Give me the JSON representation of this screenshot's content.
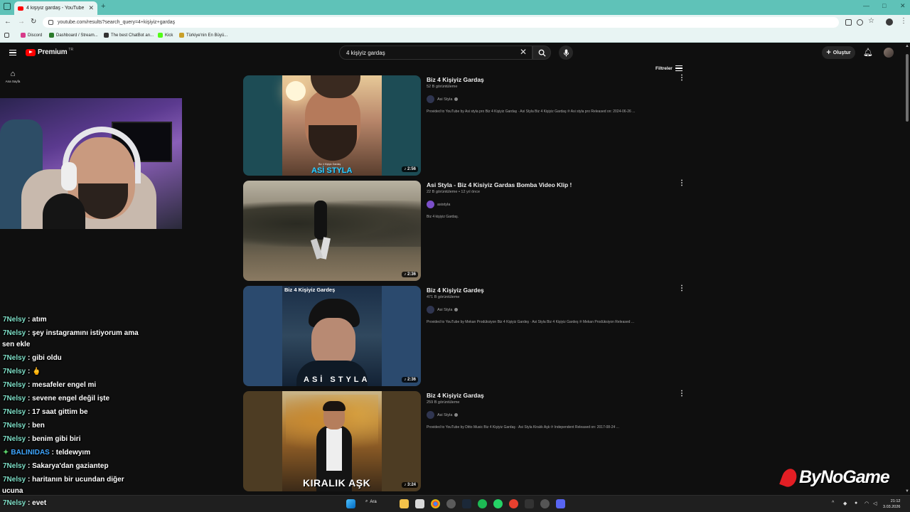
{
  "browser": {
    "tab_title": "4 kişiyiz gardaş - YouTube",
    "new_tab": "+",
    "url": "youtube.com/results?search_query=4+kişiyiz+gardaş",
    "bookmarks": [
      "Discord",
      "Dashboard / Stream...",
      "The best ChatBot an...",
      "Kick",
      "Türkiye'nin En Büyü..."
    ]
  },
  "youtube": {
    "logo_text": "Premium",
    "region": "TR",
    "search_value": "4 kişiyiz gardaş",
    "create_label": "Oluştur",
    "sidebar_home": "Ana Sayfa",
    "filters_label": "Filtreler"
  },
  "results": [
    {
      "title": "Biz 4 Kişiyiz Gardaş",
      "meta": "52 B görüntüleme",
      "channel": "Asi Styla",
      "verified": true,
      "description": "Provided to YouTube by Asi styla pro Biz 4 Kişiyiz Gardaş · Asi Styla Biz 4 Kişiyiz Gardaş ℗ Asi styla pro Released on: 2024-06-26 ...",
      "duration": "2:56",
      "thumb_text": "ASİ STYLA",
      "thumb_small": "Biz 4 Kişiyiz Gardaş"
    },
    {
      "title": "Asi Styla - Biz 4 Kisiyiz Gardas Bomba Video Klip !",
      "meta": "22 B görüntüleme • 12 yıl önce",
      "channel": "asistyla",
      "verified": false,
      "description": "Biz 4 kişiyiz Gardaş.",
      "duration": "2:36",
      "channel_avatar_color": "#7b4fc9"
    },
    {
      "title": "Biz 4 Kişiyiz Gardeş",
      "meta": "471 B görüntüleme",
      "channel": "Asi Styla",
      "verified": true,
      "description": "Provided to YouTube by Mekan Prodüksiyon Biz 4 Kişiyiz Gardeş · Asi Styla Biz 4 Kişiyiz Gardeş ℗ Mekan Prodüksiyon Released ...",
      "duration": "2:36",
      "thumb_top": "Biz 4 Kişiyiz Gardeş",
      "thumb_bottom": "ASİ STYLA"
    },
    {
      "title": "Biz 4 Kişiyiz Gardaş",
      "meta": "259 B görüntüleme",
      "channel": "Asi Styla",
      "verified": true,
      "description": "Provided to YouTube by Ditto Music Biz 4 Kişiyiz Gardaş · Asi Styla Kiralık Aşk ℗ Independent Released on: 2017-08-24 ...",
      "duration": "3:24",
      "thumb_text": "KIRALIK AŞK"
    }
  ],
  "chat": [
    {
      "user": "7Nelsy",
      "text": ": atım"
    },
    {
      "user": "7Nelsy",
      "text": ": şey instagramını istiyorum ama",
      "cont": "sen ekle"
    },
    {
      "user": "7Nelsy",
      "text": ": gibi oldu"
    },
    {
      "user": "7Nelsy",
      "text": ": 🖕"
    },
    {
      "user": "7Nelsy",
      "text": ": mesafeler engel mi"
    },
    {
      "user": "7Nelsy",
      "text": ": sevene engel değil işte"
    },
    {
      "user": "7Nelsy",
      "text": ": 17 saat gittim be"
    },
    {
      "user": "7Nelsy",
      "text": ": ben"
    },
    {
      "user": "7Nelsy",
      "text": ": benim gibi biri"
    },
    {
      "user": "BALINIDAS",
      "text": ": teldewyım",
      "badge": true
    },
    {
      "user": "7Nelsy",
      "text": ": Sakarya'dan gaziantep"
    },
    {
      "user": "7Nelsy",
      "text": ": haritanın bir ucundan diğer",
      "cont": "ucuna"
    }
  ],
  "bottom_chat": {
    "user": "7Nelsy",
    "text": ": evet"
  },
  "overlay_logo": "ByNoGame",
  "taskbar": {
    "search_label": "Ara",
    "time": "21:12",
    "date": "3.03.2026"
  },
  "colors": {
    "browser_accent": "#5fc2b8",
    "yt_red": "#ff0000",
    "chat_user": "#7fe0c8"
  }
}
